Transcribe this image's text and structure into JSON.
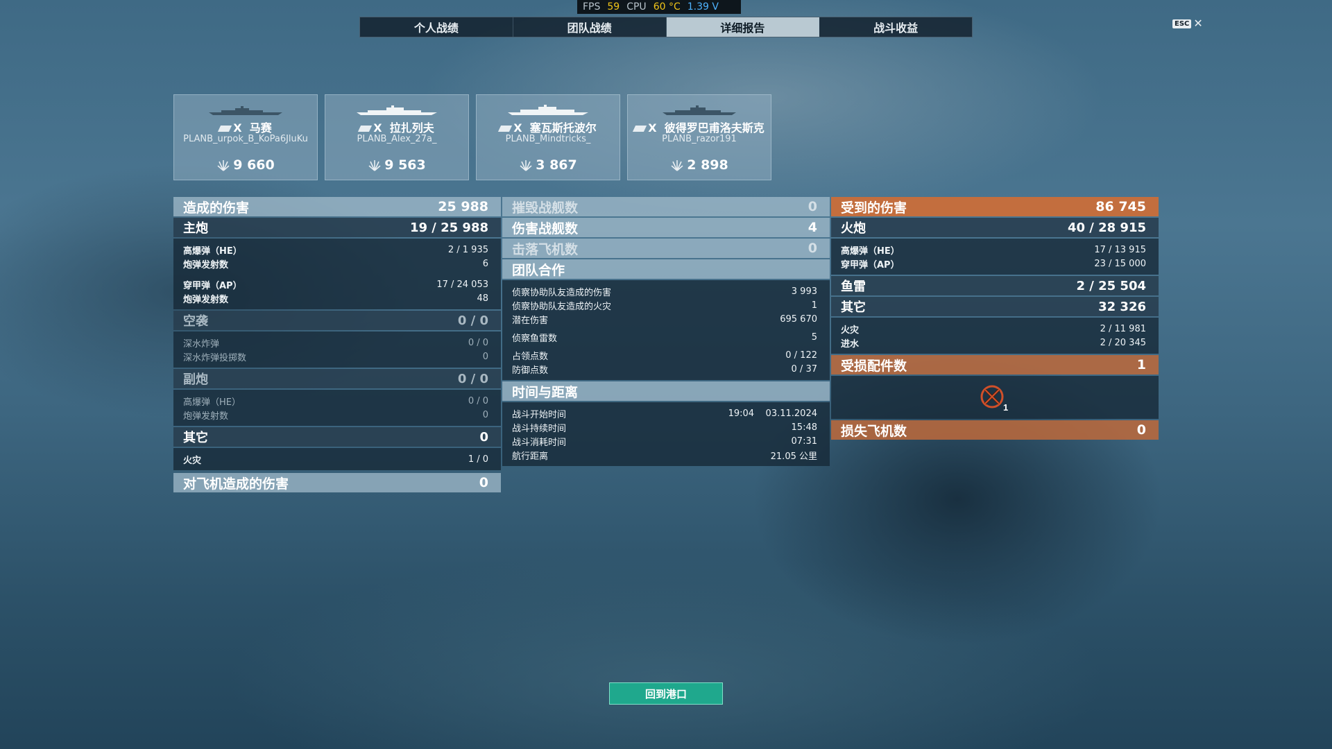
{
  "hud": {
    "fps_label": "FPS",
    "fps_value": "59",
    "cpu_label": "CPU",
    "cpu_temp": "60 °C",
    "voltage": "1.39 V"
  },
  "tabs": [
    {
      "label": "个人战绩"
    },
    {
      "label": "团队战绩"
    },
    {
      "label": "详细报告"
    },
    {
      "label": "战斗收益"
    }
  ],
  "esc": {
    "key": "ESC",
    "close": "✕"
  },
  "cards": [
    {
      "tier": "X",
      "ship": "马赛",
      "player": "PLANB_urpok_B_KoPa6JluKu",
      "score": "9 660"
    },
    {
      "tier": "X",
      "ship": "拉扎列夫",
      "player": "PLANB_Alex_27a_",
      "score": "9 563"
    },
    {
      "tier": "X",
      "ship": "塞瓦斯托波尔",
      "player": "PLANB_Mindtricks_",
      "score": "3 867"
    },
    {
      "tier": "X",
      "ship": "彼得罗巴甫洛夫斯克",
      "player": "PLANB_razor191",
      "score": "2 898"
    }
  ],
  "dealt": {
    "title": "造成的伤害",
    "total": "25 988",
    "main": {
      "title": "主炮",
      "value": "19 / 25 988",
      "rows": [
        {
          "k": "高爆弹（HE）",
          "v": "2 / 1 935"
        },
        {
          "k": "炮弹发射数",
          "v": "6"
        },
        {
          "k": "穿甲弹（AP）",
          "v": "17 / 24 053"
        },
        {
          "k": "炮弹发射数",
          "v": "48"
        }
      ]
    },
    "air": {
      "title": "空袭",
      "value": "0 / 0",
      "rows": [
        {
          "k": "深水炸弹",
          "v": "0 / 0"
        },
        {
          "k": "深水炸弹投掷数",
          "v": "0"
        }
      ]
    },
    "secondary": {
      "title": "副炮",
      "value": "0 / 0",
      "rows": [
        {
          "k": "高爆弹（HE）",
          "v": "0 / 0"
        },
        {
          "k": "炮弹发射数",
          "v": "0"
        }
      ]
    },
    "other": {
      "title": "其它",
      "value": "0",
      "rows": [
        {
          "k": "火灾",
          "v": "1 / 0"
        }
      ]
    },
    "aircraft_dmg": {
      "title": "对飞机造成的伤害",
      "value": "0"
    }
  },
  "middle": {
    "destroyed": {
      "title": "摧毁战舰数",
      "value": "0"
    },
    "damaged": {
      "title": "伤害战舰数",
      "value": "4"
    },
    "planes": {
      "title": "击落飞机数",
      "value": "0"
    },
    "team": {
      "title": "团队合作",
      "rows": [
        {
          "k": "侦察协助队友造成的伤害",
          "v": "3 993"
        },
        {
          "k": "侦察协助队友造成的火灾",
          "v": "1"
        },
        {
          "k": "潜在伤害",
          "v": "695 670"
        },
        {
          "k": "侦察鱼雷数",
          "v": "5"
        },
        {
          "k": "占领点数",
          "v": "0 / 122"
        },
        {
          "k": "防御点数",
          "v": "0 / 37"
        }
      ]
    },
    "time": {
      "title": "时间与距离",
      "rows": [
        {
          "k": "战斗开始时间",
          "v": "19:04    03.11.2024"
        },
        {
          "k": "战斗持续时间",
          "v": "15:48"
        },
        {
          "k": "战斗消耗时间",
          "v": "07:31"
        },
        {
          "k": "航行距离",
          "v": "21.05 公里"
        }
      ]
    }
  },
  "received": {
    "title": "受到的伤害",
    "total": "86 745",
    "guns": {
      "title": "火炮",
      "value": "40 / 28 915",
      "rows": [
        {
          "k": "高爆弹（HE）",
          "v": "17 / 13 915"
        },
        {
          "k": "穿甲弹（AP）",
          "v": "23 / 15 000"
        }
      ]
    },
    "torpedo": {
      "title": "鱼雷",
      "value": "2 / 25 504"
    },
    "other": {
      "title": "其它",
      "value": "32 326",
      "rows": [
        {
          "k": "火灾",
          "v": "2 / 11 981"
        },
        {
          "k": "进水",
          "v": "2 / 20 345"
        }
      ]
    },
    "modules": {
      "title": "受损配件数",
      "value": "1",
      "icon_count": "1"
    },
    "planes_lost": {
      "title": "损失飞机数",
      "value": "0"
    }
  },
  "footer": {
    "return_button": "回到港口"
  },
  "colors": {
    "active_tab": "#b9c9d2",
    "orange_header": "#cd6e37",
    "port_button": "#1fa88d"
  },
  "icons": {
    "ship": "ship-silhouette-icon",
    "score": "laurel-icon",
    "module": "damaged-module-icon"
  }
}
